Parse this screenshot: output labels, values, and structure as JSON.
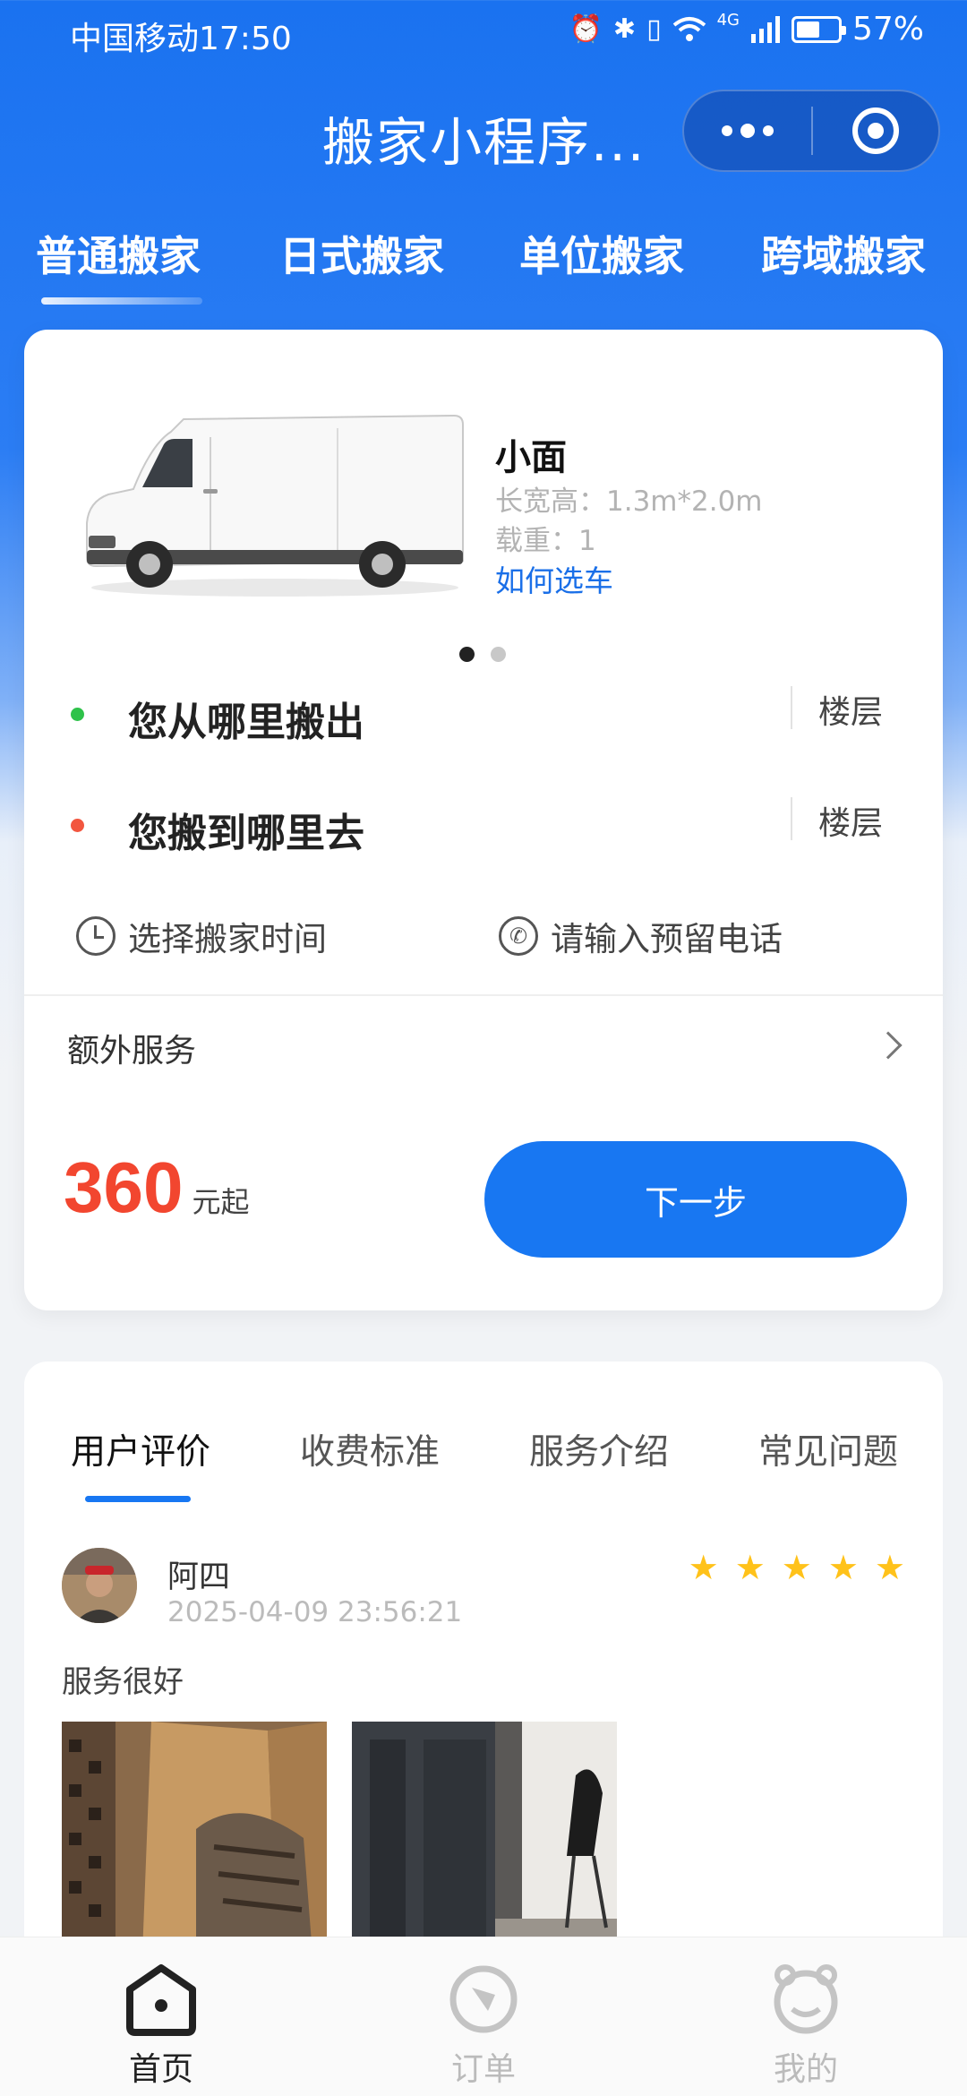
{
  "status_bar": {
    "carrier_time": "中国移动17:50",
    "signal_label": "4G",
    "battery_percent": "57%",
    "battery_level": 0.57
  },
  "title_bar": {
    "title": "搬家小程序..."
  },
  "service_tabs": [
    "普通搬家",
    "日式搬家",
    "单位搬家",
    "跨域搬家"
  ],
  "vehicle": {
    "name": "小面",
    "dimensions": "长宽高：1.3m*2.0m",
    "load": "载重：1",
    "link": "如何选车"
  },
  "address": {
    "from": "您从哪里搬出",
    "to": "您搬到哪里去",
    "floor_label": "楼层",
    "from_color": "#2ec24a",
    "to_color": "#f2563f"
  },
  "meta": {
    "time_placeholder": "选择搬家时间",
    "phone_placeholder": "请输入预留电话"
  },
  "extra_service": "额外服务",
  "price": {
    "amount": "360",
    "unit": "元起"
  },
  "next_button": "下一步",
  "info_tabs": [
    "用户评价",
    "收费标准",
    "服务介绍",
    "常见问题"
  ],
  "review": {
    "user": "阿四",
    "date": "2025-04-09 23:56:21",
    "rating": 5,
    "text": "服务很好"
  },
  "tabbar": {
    "home": "首页",
    "orders": "订单",
    "mine": "我的"
  },
  "colors": {
    "primary": "#1877f2",
    "price": "#f2462f",
    "star": "#ffc21a"
  }
}
